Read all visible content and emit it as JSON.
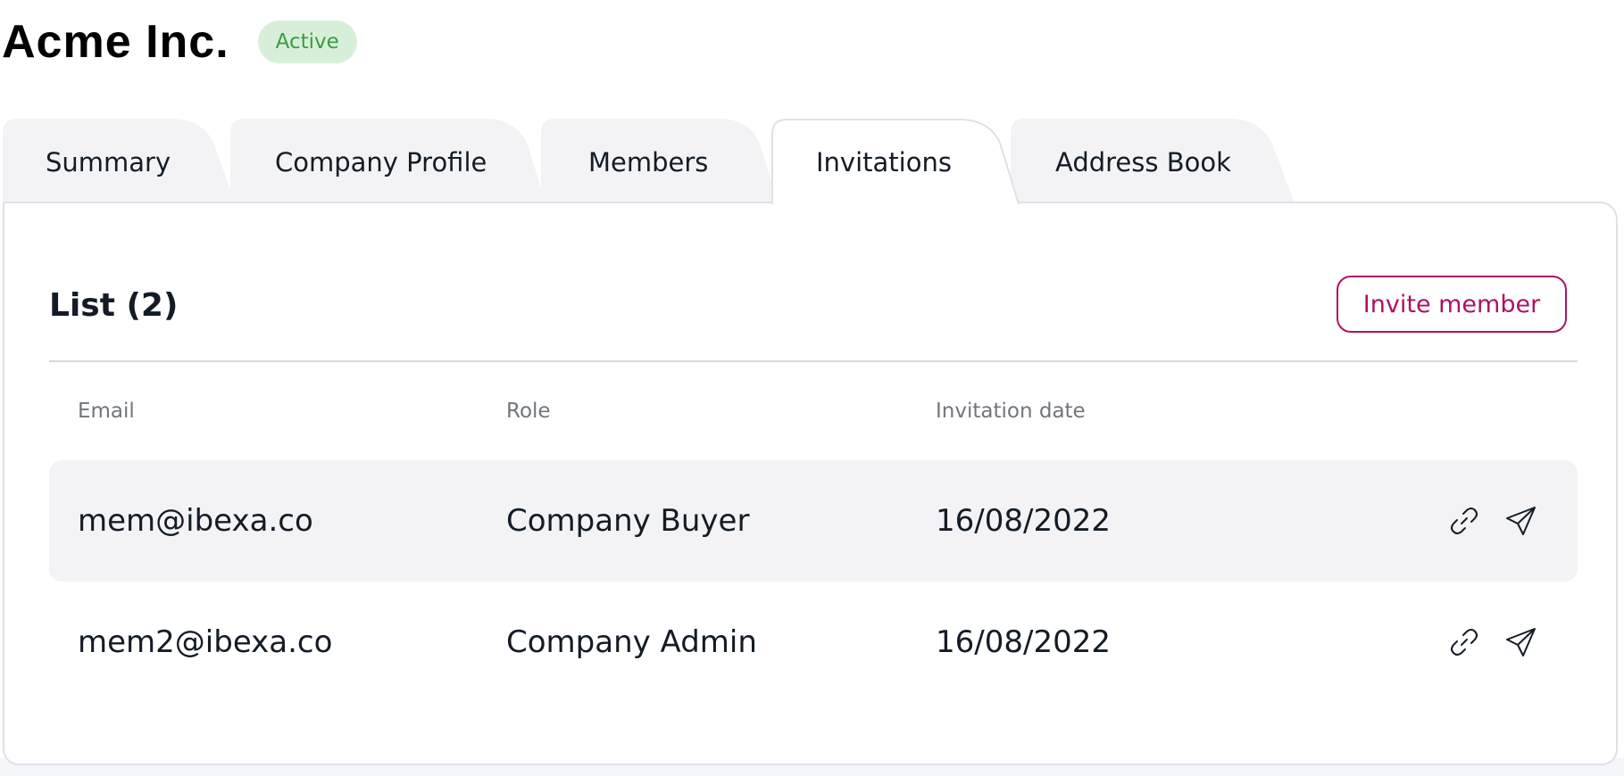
{
  "header": {
    "title": "Acme Inc.",
    "status": "Active"
  },
  "tabs": [
    {
      "label": "Summary",
      "active": false
    },
    {
      "label": "Company Profile",
      "active": false
    },
    {
      "label": "Members",
      "active": false
    },
    {
      "label": "Invitations",
      "active": true
    },
    {
      "label": "Address Book",
      "active": false
    }
  ],
  "list": {
    "title": "List (2)",
    "invite_label": "Invite member",
    "columns": [
      "Email",
      "Role",
      "Invitation date"
    ],
    "rows": [
      {
        "email": "mem@ibexa.co",
        "role": "Company Buyer",
        "date": "16/08/2022",
        "actions": [
          "link-icon",
          "send-icon"
        ]
      },
      {
        "email": "mem2@ibexa.co",
        "role": "Company Admin",
        "date": "16/08/2022",
        "actions": [
          "link-icon",
          "send-icon"
        ]
      }
    ]
  },
  "colors": {
    "accent": "#ae1164",
    "status_bg": "#d7efd9",
    "status_text": "#3c9b45",
    "tab_inactive": "#f3f3f5",
    "row_shaded": "#f3f3f5"
  }
}
